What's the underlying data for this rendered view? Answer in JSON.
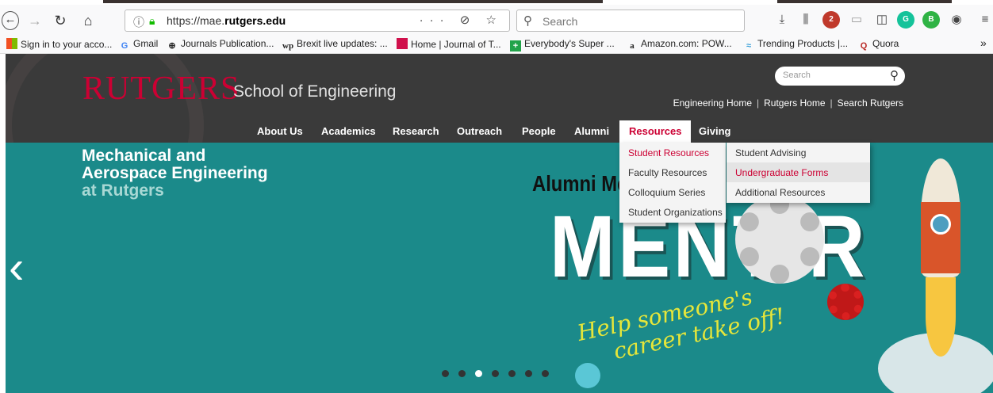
{
  "browser": {
    "url_prefix": "https://mae.",
    "url_domain": "rutgers.edu",
    "url_actions": "··· ⊘ ☆",
    "search_placeholder": "Search",
    "adblock_count": "2"
  },
  "bookmarks": [
    {
      "label": "Sign in to your acco...",
      "icon": "ms-icon"
    },
    {
      "label": "Gmail",
      "icon": "google-icon"
    },
    {
      "label": "Journals Publication...",
      "icon": "globe-icon"
    },
    {
      "label": "Brexit live updates: ...",
      "icon": "wp-icon"
    },
    {
      "label": "Home | Journal of T...",
      "icon": "red-square-icon"
    },
    {
      "label": "Everybody's Super ...",
      "icon": "green-plus-icon"
    },
    {
      "label": "Amazon.com: POW...",
      "icon": "amazon-icon"
    },
    {
      "label": "Trending Products |...",
      "icon": "trend-icon"
    },
    {
      "label": "Quora",
      "icon": "quora-icon"
    }
  ],
  "site": {
    "logo": "RUTGERS",
    "school": "School of Engineering",
    "search_placeholder": "Search",
    "toplinks": [
      "Engineering Home",
      "Rutgers Home",
      "Search Rutgers"
    ],
    "nav": [
      "About Us",
      "Academics",
      "Research",
      "Outreach",
      "People",
      "Alumni",
      "Resources",
      "Giving"
    ],
    "active_nav": "Resources"
  },
  "hero": {
    "title_line1": "Mechanical and",
    "title_line2": "Aerospace Engineering",
    "title_line3": "at Rutgers",
    "banner_top": "Alumni Me",
    "banner_big": "MENT R",
    "tagline_line1": "Help someone's",
    "tagline_line2": "career take off!"
  },
  "resources_menu": [
    "Student Resources",
    "Faculty Resources",
    "Colloquium Series",
    "Student Organizations"
  ],
  "student_resources_submenu": [
    "Student Advising",
    "Undergraduate Forms",
    "Additional Resources"
  ],
  "colors": {
    "rutgers_red": "#cc0033",
    "hero_teal": "#1b8a8a",
    "header_dark": "#3a3a3a"
  }
}
